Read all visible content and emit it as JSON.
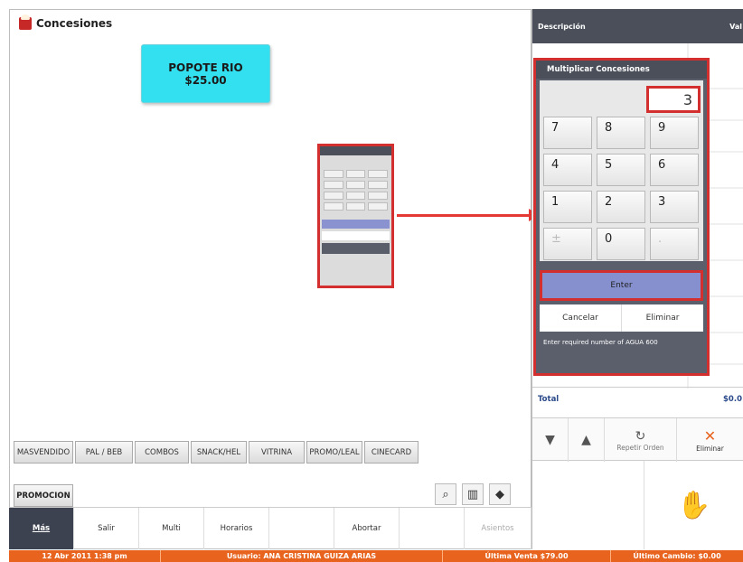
{
  "app": {
    "title": "Concesiones"
  },
  "product": {
    "name": "POPOTE RIO",
    "price": "$25.00"
  },
  "categories": [
    "MASVENDIDO",
    "PAL / BEB",
    "COMBOS",
    "SNACK/HEL",
    "VITRINA",
    "PROMO/LEAL",
    "CINECARD"
  ],
  "promotion_label": "PROMOCION",
  "bottom_bar": [
    "Más",
    "Salir",
    "Multi",
    "Horarios",
    "",
    "Abortar",
    "",
    "Asientos"
  ],
  "status": {
    "date": "12 Abr 2011 1:38 pm",
    "user": "Usuario: ANA CRISTINA GUIZA ARIAS",
    "last_sale": "Última Venta $79.00",
    "last_change": "Último Cambio: $0.00"
  },
  "order": {
    "col_description": "Descripción",
    "col_value": "Val",
    "total_label": "Total",
    "total_value": "$0.0"
  },
  "actions": {
    "repeat": "Repetir Orden",
    "delete": "Eliminar"
  },
  "dialog": {
    "title": "Multiplicar Concesiones",
    "display_value": "3",
    "keys": [
      "7",
      "8",
      "9",
      "4",
      "5",
      "6",
      "1",
      "2",
      "3",
      "±",
      "0",
      "."
    ],
    "enter": "Enter",
    "cancel": "Cancelar",
    "delete": "Eliminar",
    "message": "Enter required number of AGUA 600"
  },
  "colors": {
    "accent": "#e8641e",
    "tile": "#33e0ef",
    "highlight": "#d32f2f",
    "enter": "#8690cf"
  }
}
